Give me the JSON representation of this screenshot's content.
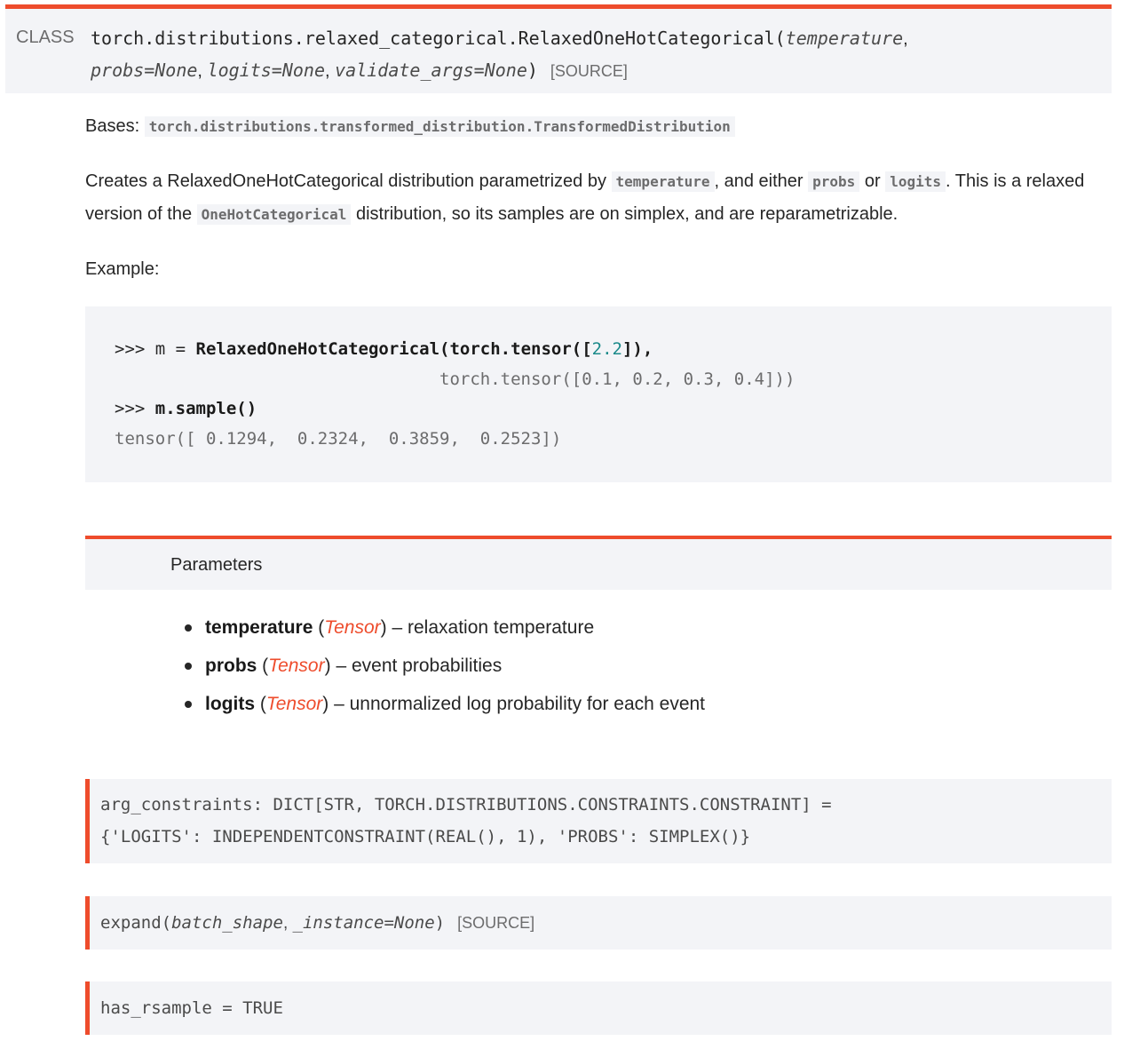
{
  "signature": {
    "keyword": "CLASS",
    "name": "torch.distributions.relaxed_categorical.RelaxedOneHotCategorical",
    "params": [
      "temperature",
      "probs=None",
      "logits=None",
      "validate_args=None"
    ],
    "source_label": "[SOURCE]"
  },
  "bases": {
    "label": "Bases:",
    "value": "torch.distributions.transformed_distribution.TransformedDistribution"
  },
  "description": {
    "part1": "Creates a RelaxedOneHotCategorical distribution parametrized by ",
    "code1": "temperature",
    "part2": ", and either ",
    "code2": "probs",
    "part3": " or ",
    "code3": "logits",
    "part4": ". This is a relaxed version of the ",
    "code4": "OneHotCategorical",
    "part5": " distribution, so its samples are on simplex, and are reparametrizable."
  },
  "example_label": "Example:",
  "code": {
    "l1_prompt": ">>> m = ",
    "l1_call": "RelaxedOneHotCategorical(torch.tensor([",
    "l1_num": "2.2",
    "l1_end": "]),",
    "l2": "                                torch.tensor([0.1, 0.2, 0.3, 0.4]))",
    "l3_prompt": ">>> ",
    "l3_call": "m.sample()",
    "l4": "tensor([ 0.1294,  0.2324,  0.3859,  0.2523])"
  },
  "parameters": {
    "heading": "Parameters",
    "items": [
      {
        "name": "temperature",
        "type": "Tensor",
        "desc": " – relaxation temperature"
      },
      {
        "name": "probs",
        "type": "Tensor",
        "desc": " – event probabilities"
      },
      {
        "name": "logits",
        "type": "Tensor",
        "desc": " – unnormalized log probability for each event"
      }
    ]
  },
  "attributes": {
    "arg_constraints_line1": "arg_constraints: DICT[STR, TORCH.DISTRIBUTIONS.CONSTRAINTS.CONSTRAINT] =",
    "arg_constraints_line2": "{'LOGITS': INDEPENDENTCONSTRAINT(REAL(), 1), 'PROBS': SIMPLEX()}",
    "expand_name": "expand",
    "expand_params": [
      "batch_shape",
      "_instance=None"
    ],
    "expand_source": "[SOURCE]",
    "has_rsample": "has_rsample = TRUE"
  },
  "colors": {
    "accent": "#ee4c2c",
    "panel": "#f3f4f7",
    "number": "#1b8a8a"
  }
}
